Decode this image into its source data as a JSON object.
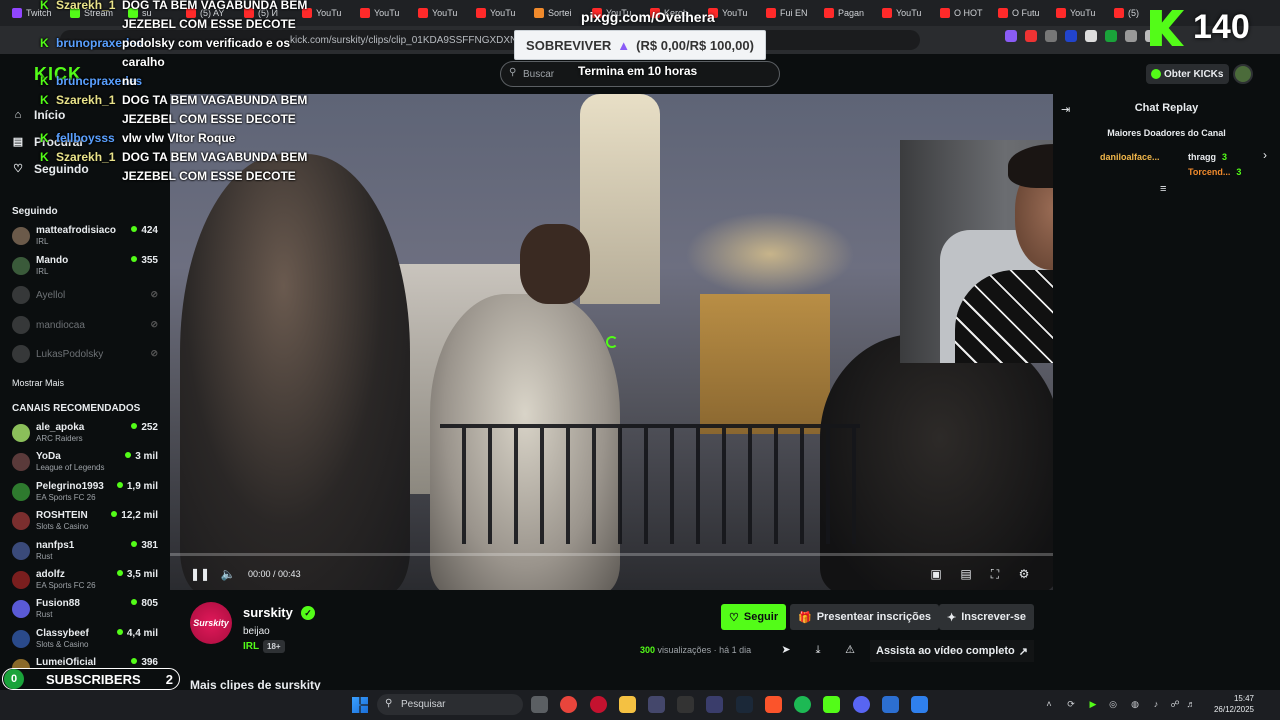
{
  "browser": {
    "tabs": [
      {
        "label": "Twitch",
        "color": "#9146ff"
      },
      {
        "label": "Stream",
        "color": "#53fc18"
      },
      {
        "label": "su",
        "color": "#53fc18"
      },
      {
        "label": "(5) AY",
        "color": "#ff2a2a"
      },
      {
        "label": "(5) И",
        "color": "#ff2a2a"
      },
      {
        "label": "YouTu",
        "color": "#ff2a2a"
      },
      {
        "label": "YouTu",
        "color": "#ff2a2a"
      },
      {
        "label": "YouTu",
        "color": "#ff2a2a"
      },
      {
        "label": "YouTu",
        "color": "#ff2a2a"
      },
      {
        "label": "Sortei",
        "color": "#f08a2c"
      },
      {
        "label": "YouTu",
        "color": "#ff2a2a"
      },
      {
        "label": "Kerob",
        "color": "#ff2a2a"
      },
      {
        "label": "YouTu",
        "color": "#ff2a2a"
      },
      {
        "label": "Fui EN",
        "color": "#ff2a2a"
      },
      {
        "label": "Pagan",
        "color": "#ff2a2a"
      },
      {
        "label": "YouTu",
        "color": "#ff2a2a"
      },
      {
        "label": "O HOT",
        "color": "#ff2a2a"
      },
      {
        "label": "O Futu",
        "color": "#ff2a2a"
      },
      {
        "label": "YouTu",
        "color": "#ff2a2a"
      },
      {
        "label": "(5)",
        "color": "#ff2a2a"
      }
    ],
    "url": "kick.com/surskity/clips/clip_01KDA9SSFFNGXDXNW9JKDFWB17"
  },
  "header": {
    "logo": "KICK",
    "search_placeholder": "Buscar",
    "get_kicks": "Obter KICKs"
  },
  "sidebar": {
    "nav": [
      {
        "label": "Início",
        "icon": "home-icon"
      },
      {
        "label": "Procurar",
        "icon": "browse-icon"
      },
      {
        "label": "Seguindo",
        "icon": "heart-icon"
      }
    ],
    "following_title": "Seguindo",
    "following": [
      {
        "name": "matteafrodisiaco",
        "sub": "IRL",
        "count": "424",
        "live": true,
        "color": "#6b5a4a"
      },
      {
        "name": "Mando",
        "sub": "IRL",
        "count": "355",
        "live": true,
        "color": "#3a5a3a"
      },
      {
        "name": "Ayellol",
        "sub": "",
        "count": "",
        "live": false,
        "color": "#777"
      },
      {
        "name": "mandiocaa",
        "sub": "",
        "count": "",
        "live": false,
        "color": "#777"
      },
      {
        "name": "LukasPodolsky",
        "sub": "",
        "count": "",
        "live": false,
        "color": "#777"
      }
    ],
    "show_more": "Mostrar Mais",
    "recommended_title": "CANAIS RECOMENDADOS",
    "recommended": [
      {
        "name": "ale_apoka",
        "sub": "ARC Raiders",
        "count": "252",
        "color": "#8bbf5a"
      },
      {
        "name": "YoDa",
        "sub": "League of Legends",
        "count": "3 mil",
        "color": "#5a3a3a"
      },
      {
        "name": "Pelegrino1993",
        "sub": "EA Sports FC 26",
        "count": "1,9 mil",
        "color": "#2e7a2e"
      },
      {
        "name": "ROSHTEIN",
        "sub": "Slots & Casino",
        "count": "12,2 mil",
        "color": "#7a2e2e"
      },
      {
        "name": "nanfps1",
        "sub": "Rust",
        "count": "381",
        "color": "#3a4a7a"
      },
      {
        "name": "adolfz",
        "sub": "EA Sports FC 26",
        "count": "3,5 mil",
        "color": "#7a1e1e"
      },
      {
        "name": "Fusion88",
        "sub": "Rust",
        "count": "805",
        "color": "#5a5ad6"
      },
      {
        "name": "Classybeef",
        "sub": "Slots & Casino",
        "count": "4,4 mil",
        "color": "#2a4a8a"
      },
      {
        "name": "LumeiOficial",
        "sub": "",
        "count": "396",
        "color": "#8a6a2a"
      }
    ]
  },
  "overlay": {
    "chat": [
      {
        "user": "Szarekh_1",
        "msg": "DOG TA BEM VAGABUNDA BEM"
      },
      {
        "user": "",
        "msg": "JEZEBEL COM ESSE DECOTE"
      },
      {
        "user": "brunopraxedes",
        "msg": "podolsky com verificado e os"
      },
      {
        "user": "",
        "msg": "caralho"
      },
      {
        "user": "bruncpraxedes",
        "msg": "nu"
      },
      {
        "user": "Szarekh_1",
        "msg": "DOG TA BEM VAGABUNDA BEM"
      },
      {
        "user": "",
        "msg": "JEZEBEL COM ESSE DECOTE"
      },
      {
        "user": "fellboysss",
        "msg": "vlw vlw VItor Roque"
      },
      {
        "user": "Szarekh_1",
        "msg": "DOG TA BEM VAGABUNDA BEM"
      },
      {
        "user": "",
        "msg": "JEZEBEL COM ESSE DECOTE"
      }
    ],
    "pix_url": "pixgg.com/Ovelhera",
    "goal_label": "SOBREVIVER",
    "goal_value": "(R$ 0,00/R$ 100,00)",
    "goal_end": "Termina em 10 horas",
    "kick_count": "140",
    "subscribers_count_left": "0",
    "subscribers_label": "SUBSCRIBERS",
    "subscribers_count_right": "2"
  },
  "video": {
    "time_current": "00:00",
    "time_total": "00:43",
    "progress": 0.0
  },
  "chat_replay": {
    "title": "Chat Replay",
    "top_donors_title": "Maiores Doadores do Canal",
    "donors": [
      {
        "name": "daniloalface...",
        "amount": "",
        "color": "#f0b64a"
      },
      {
        "name": "thragg",
        "amount": "3",
        "color": "#e9ecef"
      },
      {
        "name": "Torcend...",
        "amount": "3",
        "color": "#f08a2c"
      }
    ]
  },
  "channel": {
    "avatar_text": "Surskity",
    "name": "surskity",
    "clip_title": "beijao",
    "category": "IRL",
    "age_badge": "18+",
    "follow": "Seguir",
    "gift": "Presentear inscrições",
    "subscribe": "Inscrever-se",
    "views_count": "300",
    "views_label": "visualizações",
    "time_ago": "há 1 dia",
    "watch_full": "Assista ao vídeo completo",
    "more_clips": "Mais clipes de surskity"
  },
  "taskbar": {
    "search": "Pesquisar",
    "time": "15:47",
    "date": "26/12/2025"
  }
}
